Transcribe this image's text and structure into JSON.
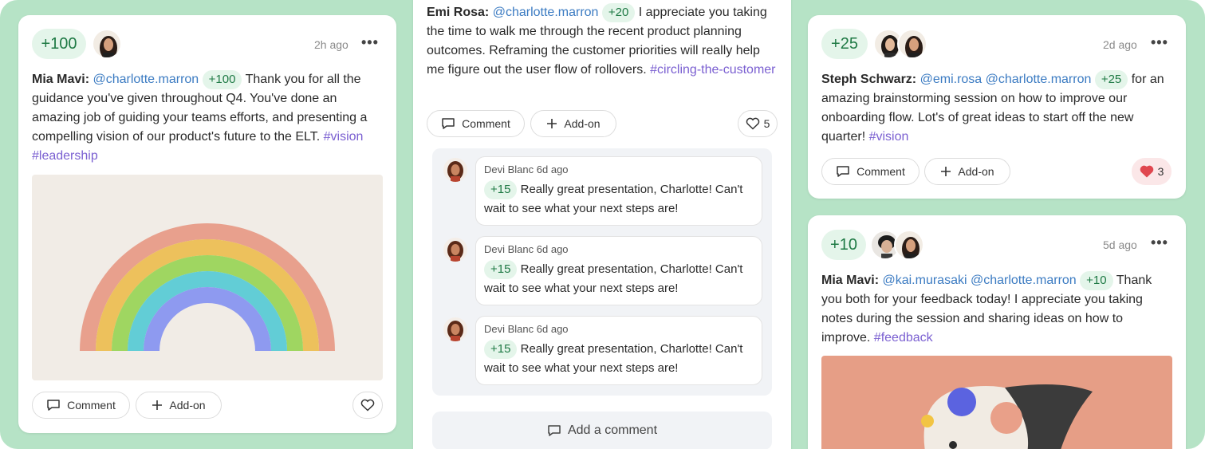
{
  "colors": {
    "frame": "#b6e3c6",
    "badge_bg": "#e4f5ea",
    "badge_text": "#1f7a45",
    "mention": "#3b7bc2",
    "tag": "#7a5fd1",
    "heart_red": "#e0474f"
  },
  "card1": {
    "points": "+100",
    "time": "2h ago",
    "menu": "•••",
    "author": "Mia Mavi:",
    "mention": "@charlotte.marron",
    "badge": "+100",
    "text": " Thank you for all the guidance you've given throughout Q4. You've done an amazing job of guiding your teams efforts, and presenting a compelling vision of our product's future to the ELT. ",
    "tags": [
      "#vision",
      "#leadership"
    ],
    "comment_label": "Comment",
    "addon_label": "Add-on"
  },
  "card2": {
    "author": "Emi Rosa:",
    "mention": "@charlotte.marron",
    "badge": "+20",
    "text": " I appreciate you taking the time to walk me through the recent product planning outcomes. Reframing the customer priorities will really help me figure out the user flow of rollovers. ",
    "tag": "#circling-the-customer",
    "comment_label": "Comment",
    "addon_label": "Add-on",
    "likes": "5",
    "replies": [
      {
        "author": "Devi Blanc",
        "time": "6d ago",
        "badge": "+15",
        "text": "Really great presentation, Charlotte! Can't wait to see what your next steps are!"
      },
      {
        "author": "Devi Blanc",
        "time": "6d ago",
        "badge": "+15",
        "text": "Really great presentation, Charlotte! Can't wait to see what your next steps are!"
      },
      {
        "author": "Devi Blanc",
        "time": "6d ago",
        "badge": "+15",
        "text": "Really great presentation, Charlotte! Can't wait to see what your next steps are!"
      }
    ],
    "add_comment": "Add a comment"
  },
  "card3": {
    "points": "+25",
    "time": "2d ago",
    "menu": "•••",
    "author": "Steph Schwarz:",
    "mention1": "@emi.rosa",
    "mention2": "@charlotte.marron",
    "badge": "+25",
    "text": " for an amazing brainstorming session on how to improve our onboarding flow. Lot's of great ideas to start off the new quarter! ",
    "tag": "#vision",
    "comment_label": "Comment",
    "addon_label": "Add-on",
    "likes": "3"
  },
  "card4": {
    "points": "+10",
    "time": "5d ago",
    "menu": "•••",
    "author": "Mia Mavi:",
    "mention1": "@kai.murasaki",
    "mention2": "@charlotte.marron",
    "badge": "+10",
    "text": " Thank you both for your feedback today! I appreciate you taking notes during the session and sharing ideas on how to improve. ",
    "tag": "#feedback"
  }
}
